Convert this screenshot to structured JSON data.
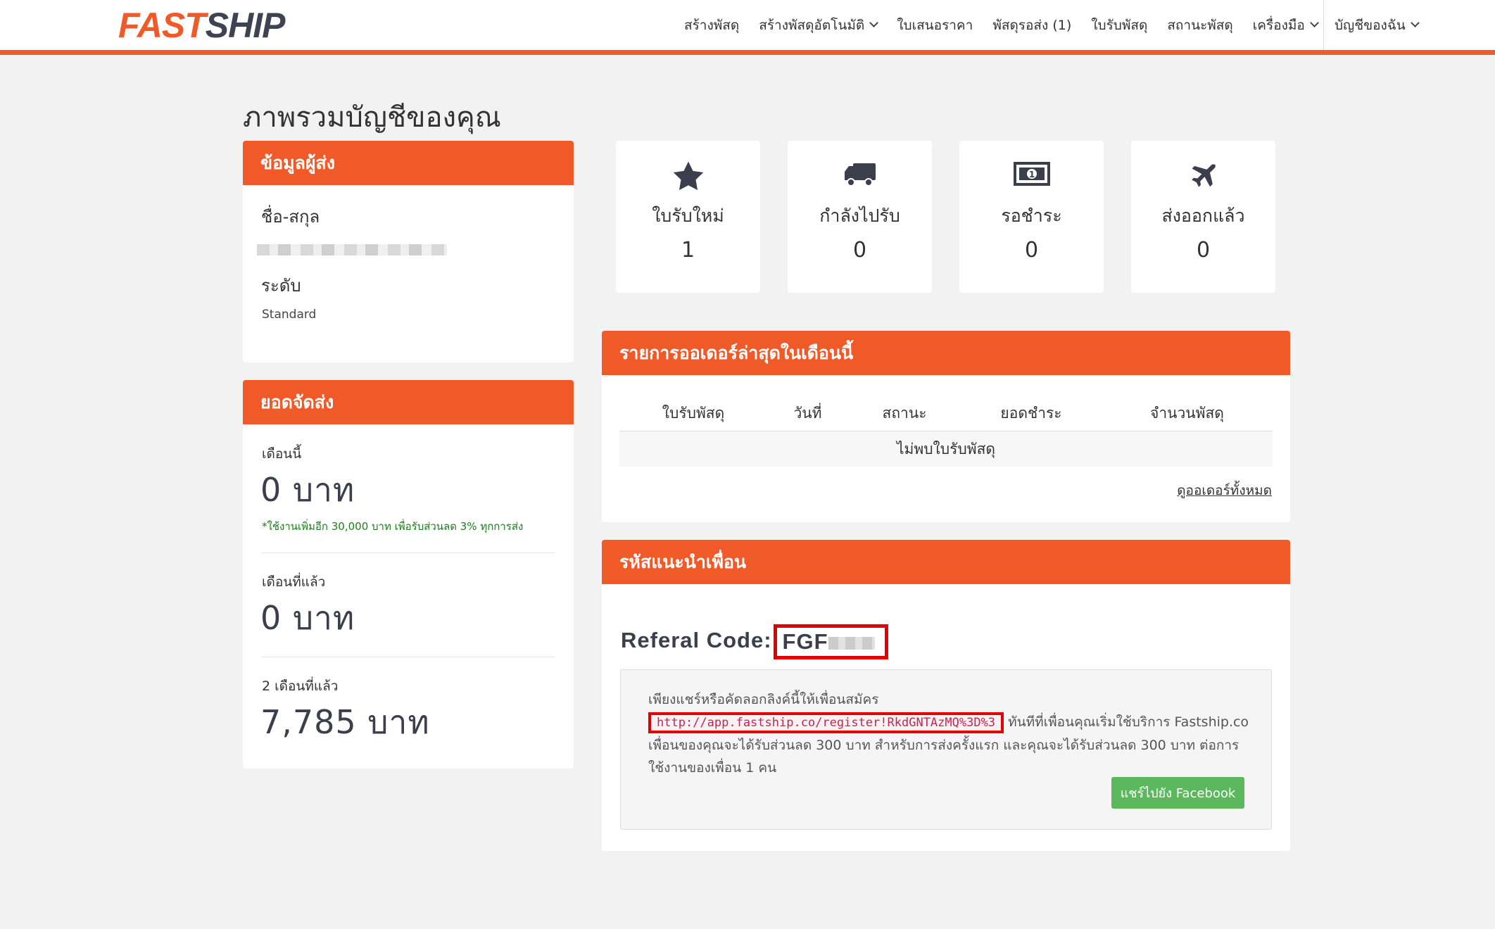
{
  "brand": {
    "fast": "FAST",
    "ship": "SHIP",
    "accent": "#f05a28"
  },
  "nav": {
    "items": [
      {
        "label": "สร้างพัสดุ",
        "dropdown": false
      },
      {
        "label": "สร้างพัสดุอัตโนมัติ",
        "dropdown": true
      },
      {
        "label": "ใบเสนอราคา",
        "dropdown": false
      },
      {
        "label": "พัสดุรอส่ง (1)",
        "dropdown": false
      },
      {
        "label": "ใบรับพัสดุ",
        "dropdown": false
      },
      {
        "label": "สถานะพัสดุ",
        "dropdown": false
      },
      {
        "label": "เครื่องมือ",
        "dropdown": true
      }
    ],
    "account": "บัญชีของฉัน"
  },
  "page_title": "ภาพรวมบัญชีของคุณ",
  "sender": {
    "title": "ข้อมูลผู้ส่ง",
    "name_label": "ชื่อ-สกุล",
    "level_label": "ระดับ",
    "level_value": "Standard"
  },
  "shipping": {
    "title": "ยอดจัดส่ง",
    "this_month_label": "เดือนนี้",
    "this_month_value": "0 บาท",
    "note": "*ใช้งานเพิ่มอีก 30,000 บาท เพื่อรับส่วนลด 3% ทุกการส่ง",
    "last_month_label": "เดือนที่แล้ว",
    "last_month_value": "0 บาท",
    "two_months_label": "2 เดือนที่แล้ว",
    "two_months_value": "7,785 บาท"
  },
  "stats": [
    {
      "icon": "star-icon",
      "label": "ใบรับใหม่",
      "value": "1"
    },
    {
      "icon": "truck-icon",
      "label": "กำลังไปรับ",
      "value": "0"
    },
    {
      "icon": "money-icon",
      "label": "รอชำระ",
      "value": "0"
    },
    {
      "icon": "plane-icon",
      "label": "ส่งออกแล้ว",
      "value": "0"
    }
  ],
  "orders": {
    "title": "รายการออเดอร์ล่าสุดในเดือนนี้",
    "columns": [
      "ใบรับพัสดุ",
      "วันที่",
      "สถานะ",
      "ยอดชำระ",
      "จำนวนพัสดุ"
    ],
    "empty": "ไม่พบใบรับพัสดุ",
    "view_all": "ดูออเดอร์ทั้งหมด"
  },
  "referral": {
    "title": "รหัสแนะนำเพื่อน",
    "code_label": "Referal Code:",
    "code_value": "FGF",
    "intro": "เพียงแชร์หรือคัดลอกลิงค์นี้ให้เพื่อนสมัคร",
    "link": "http://app.fastship.co/register!RkdGNTAzMQ%3D%3",
    "description": "ทันทีที่เพื่อนคุณเริ่มใช้บริการ Fastship.co เพื่อนของคุณจะได้รับส่วนลด 300 บาท สำหรับการส่งครั้งแรก และคุณจะได้รับส่วนลด 300 บาท ต่อการใช้งานของเพื่อน 1 คน",
    "share_button": "แชร์ไปยัง Facebook"
  }
}
